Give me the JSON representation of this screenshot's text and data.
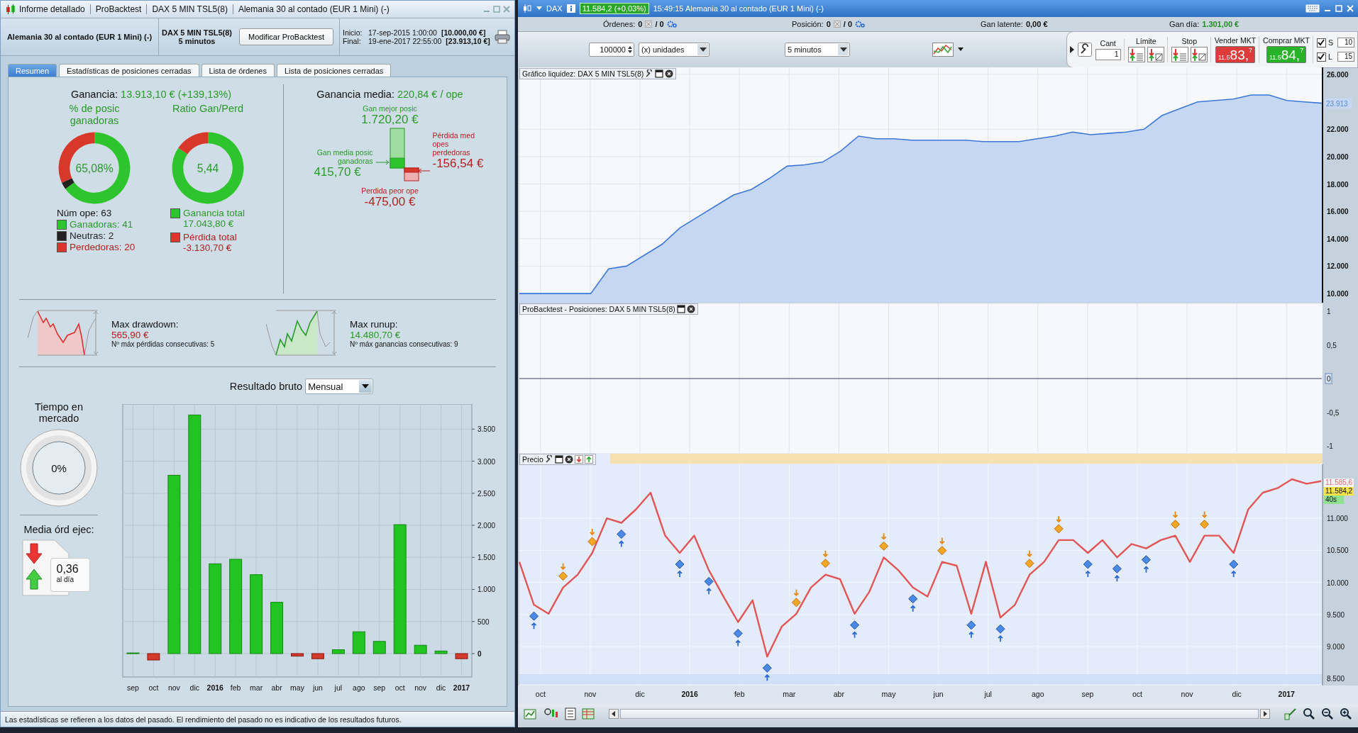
{
  "report_window": {
    "title_items": [
      "Informe detallado",
      "ProBacktest",
      "DAX 5 MIN TSL5(8)",
      "Alemania 30 al contado (EUR 1 Mini) (-)"
    ],
    "header": {
      "instrument": "Alemania 30 al contado (EUR 1 Mini) (-)",
      "system": "DAX 5 MIN TSL5(8)",
      "timeframe": "5 minutos",
      "modify_button": "Modificar ProBacktest",
      "start_label": "Inicio:",
      "start_date": "17-sep-2015 1:00:00",
      "start_capital": "[10.000,00 €]",
      "end_label": "Final:",
      "end_date": "19-ene-2017 22:55:00",
      "end_capital": "[23.913,10 €]"
    },
    "tabs": [
      {
        "label": "Resumen",
        "selected": true
      },
      {
        "label": "Estadísticas de posiciones cerradas",
        "selected": false
      },
      {
        "label": "Lista de órdenes",
        "selected": false
      },
      {
        "label": "Lista de posiciones cerradas",
        "selected": false
      }
    ],
    "summary": {
      "gain_label": "Ganancia:",
      "gain_value": "13.913,10 € (+139,13%)",
      "win_donut": {
        "title": "% de posic ganadoras",
        "center": "65,08%",
        "chart_data": {
          "type": "donut",
          "values": [
            65.08,
            3.17,
            31.75
          ]
        }
      },
      "ratio_donut": {
        "title": "Ratio Gan/Perd",
        "center": "5,44",
        "chart_data": {
          "type": "donut",
          "values": [
            84.48,
            15.52
          ]
        }
      },
      "num_ope": "Núm ope: 63",
      "win_legend": [
        {
          "label": "Ganadoras: 41",
          "color": "#2ec42e"
        },
        {
          "label": "Neutras: 2",
          "color": "#222222"
        },
        {
          "label": "Perdedoras: 20",
          "color": "#d8382a"
        }
      ],
      "ratio_legend": [
        {
          "label": "Ganancia total",
          "value": "17.043,80 €",
          "color": "#2ec42e"
        },
        {
          "label": "Pérdida total",
          "value": "-3.130,70 €",
          "color": "#d8382a"
        }
      ],
      "avg_label": "Ganancia media:",
      "avg_value": "220,84 € / ope",
      "best_label": "Gan mejor posic",
      "best_value": "1.720,20 €",
      "avg_win_label": "Gan media posic ganadoras",
      "avg_win_value": "415,70 €",
      "avg_loss_label": "Pérdida med opes perdedoras",
      "avg_loss_value": "-156,54 €",
      "worst_label": "Perdida peor ope",
      "worst_value": "-475,00 €",
      "drawdown": {
        "label": "Max drawdown:",
        "value": "565,90 €",
        "note": "Nº máx pérdidas consecutivas: 5"
      },
      "runup": {
        "label": "Max runup:",
        "value": "14.480,70 €",
        "note": "Nº máx ganancias consecutivas: 9"
      },
      "market_time": {
        "label": "Tiempo en mercado",
        "value": "0%"
      },
      "orders": {
        "label": "Media órd ejec:",
        "value": "0,36",
        "unit": "al día"
      },
      "result": {
        "label": "Resultado bruto",
        "period": "Mensual",
        "bold_categories": [
          false,
          false,
          false,
          false,
          true,
          false,
          false,
          false,
          false,
          false,
          false,
          false,
          false,
          false,
          false,
          false,
          true
        ],
        "chart_data": {
          "type": "bar",
          "categories": [
            "sep",
            "oct",
            "nov",
            "dic",
            "2016",
            "feb",
            "mar",
            "abr",
            "may",
            "jun",
            "jul",
            "ago",
            "sep",
            "oct",
            "nov",
            "dic",
            "2017"
          ],
          "values": [
            10,
            -100,
            2780,
            3720,
            1400,
            1470,
            1230,
            800,
            -40,
            -80,
            60,
            340,
            190,
            2010,
            130,
            40,
            -80
          ],
          "ylim": [
            -365,
            3890
          ],
          "grid": true,
          "yticks": [
            {
              "value": 0,
              "label": "0"
            },
            {
              "value": 500,
              "label": "500"
            },
            {
              "value": 1000,
              "label": "1.000"
            },
            {
              "value": 1500,
              "label": "1.500"
            },
            {
              "value": 2000,
              "label": "2.000"
            },
            {
              "value": 2500,
              "label": "2.500"
            },
            {
              "value": 3000,
              "label": "3.000"
            },
            {
              "value": 3500,
              "label": "3.500"
            }
          ]
        }
      }
    },
    "status": "Las estadísticas se refieren a los datos del pasado. El rendimiento del pasado no es indicativo de los resultados futuros."
  },
  "chart_window": {
    "title": "DAX",
    "quote": "11.584,2 (+0,03%)",
    "subtitle": "15:49:15 Alemania 30 al contado (EUR 1 Mini) (-)",
    "info_bar": [
      {
        "label": "Órdenes:",
        "value": "0",
        "total": "/ 0",
        "kind": "count"
      },
      {
        "label": "Posición:",
        "value": "0",
        "total": "/ 0",
        "kind": "count"
      },
      {
        "label": "Gan latente:",
        "value": "0,00 €",
        "kind": "money"
      },
      {
        "label": "Gan día:",
        "value": "1.301,00 €",
        "kind": "gain"
      }
    ],
    "toolbar": {
      "quantity": "100000",
      "units": "(x) unidades",
      "timeframe": "5 minutos"
    },
    "order_panel": {
      "cant_label": "Cant",
      "cant_value": "1",
      "limit_label": "Límite",
      "stop_label": "Stop",
      "trade_buttons": [
        {
          "kind": "sell",
          "label": "Vender MKT",
          "prefix": "11.5",
          "big": "83,",
          "sup": "7"
        },
        {
          "kind": "buy",
          "label": "Comprar MKT",
          "prefix": "11.5",
          "big": "84,",
          "sup": "7"
        }
      ],
      "checks": [
        {
          "label": "S",
          "checked": true,
          "value": "10"
        },
        {
          "label": "L",
          "checked": true,
          "value": "15"
        }
      ]
    },
    "equity_pane": {
      "title": "Gráfico liquidez: DAX 5 MIN TSL5(8)",
      "last_label": "23.913",
      "chart_data": {
        "type": "area",
        "values": [
          10000,
          10000,
          10000,
          10000,
          10000,
          11800,
          12000,
          12800,
          13600,
          14800,
          15600,
          16400,
          17200,
          17600,
          18400,
          19300,
          19400,
          19600,
          20400,
          21500,
          21300,
          21300,
          21200,
          21200,
          21200,
          21200,
          21100,
          21100,
          21100,
          21300,
          21500,
          21800,
          21600,
          21700,
          21800,
          22000,
          23000,
          23500,
          24000,
          24100,
          24200,
          24500,
          24500,
          24100,
          24000,
          23900
        ],
        "ylim": [
          9330,
          26520
        ],
        "grid": true,
        "yticks": [
          {
            "value": 10000,
            "label": "10.000"
          },
          {
            "value": 12000,
            "label": "12.000"
          },
          {
            "value": 14000,
            "label": "14.000"
          },
          {
            "value": 16000,
            "label": "16.000"
          },
          {
            "value": 18000,
            "label": "18.000"
          },
          {
            "value": 20000,
            "label": "20.000"
          },
          {
            "value": 22000,
            "label": "22.000"
          },
          {
            "value": 26000,
            "label": "26.000"
          }
        ]
      }
    },
    "positions_pane": {
      "title": "ProBacktest - Posiciones: DAX 5 MIN TSL5(8)",
      "axis_labels": [
        {
          "text": "1",
          "boxed": false
        },
        {
          "text": "0,5",
          "boxed": false
        },
        {
          "text": "0",
          "boxed": true
        },
        {
          "text": "-0,5",
          "boxed": false
        },
        {
          "text": "-1",
          "boxed": false
        }
      ]
    },
    "price_pane": {
      "title": "Precio",
      "price_labels": [
        {
          "kind": "ask",
          "text": "11.585,6"
        },
        {
          "kind": "last",
          "text": "11.584,2"
        },
        {
          "kind": "timer",
          "text": "40s"
        }
      ],
      "chart_data": {
        "type": "line",
        "values": [
          10320,
          9650,
          9510,
          9920,
          10120,
          10460,
          11000,
          10930,
          11140,
          11400,
          10730,
          10460,
          10730,
          10190,
          9780,
          9380,
          9720,
          8840,
          9310,
          9510,
          9920,
          10120,
          10050,
          9510,
          9850,
          10390,
          10190,
          9920,
          9780,
          10320,
          10260,
          9510,
          10320,
          9450,
          9650,
          10120,
          10320,
          10660,
          10660,
          10460,
          10660,
          10390,
          10600,
          10530,
          10660,
          10730,
          10320,
          10730,
          10730,
          10460,
          11140,
          11400,
          11470,
          11610,
          11540,
          11580
        ],
        "ylim": [
          8390,
          12020
        ],
        "grid": true,
        "yticks": [
          {
            "value": 8500,
            "label": "8.500"
          },
          {
            "value": 9000,
            "label": "9.000"
          },
          {
            "value": 9500,
            "label": "9.500"
          },
          {
            "value": 10000,
            "label": "10.000"
          },
          {
            "value": 10500,
            "label": "10.500"
          },
          {
            "value": 11000,
            "label": "11.000"
          }
        ]
      }
    },
    "time_axis": [
      {
        "text": "oct",
        "bold": false
      },
      {
        "text": "nov",
        "bold": false
      },
      {
        "text": "dic",
        "bold": false
      },
      {
        "text": "2016",
        "bold": true
      },
      {
        "text": "feb",
        "bold": false
      },
      {
        "text": "mar",
        "bold": false
      },
      {
        "text": "abr",
        "bold": false
      },
      {
        "text": "may",
        "bold": false
      },
      {
        "text": "jun",
        "bold": false
      },
      {
        "text": "jul",
        "bold": false
      },
      {
        "text": "ago",
        "bold": false
      },
      {
        "text": "sep",
        "bold": false
      },
      {
        "text": "oct",
        "bold": false
      },
      {
        "text": "nov",
        "bold": false
      },
      {
        "text": "dic",
        "bold": false
      },
      {
        "text": "2017",
        "bold": true
      }
    ]
  }
}
